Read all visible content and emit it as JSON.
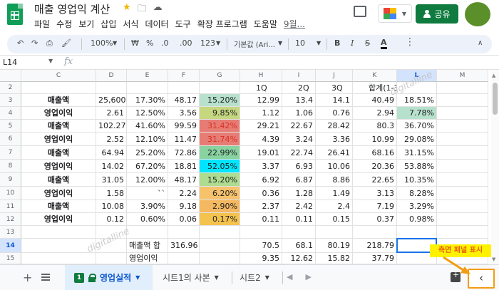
{
  "header": {
    "doc_title": "매출 영업익 계산",
    "menu": [
      "파일",
      "수정",
      "보기",
      "삽입",
      "서식",
      "데이터",
      "도구",
      "확장 프로그램",
      "도움말"
    ],
    "menu_last": "9월...",
    "share_label": "공유"
  },
  "toolbar": {
    "zoom": "100%",
    "currency": "₩",
    "percent": "%",
    "decimal_less": ".0",
    "decimal_more": ".00",
    "more_formats": "123",
    "font": "기본값 (Ari...",
    "font_size": "10",
    "bold": "B",
    "italic": "I",
    "strike": "S",
    "text_color": "A"
  },
  "formula_bar": {
    "name_box": "L14",
    "fx": "fx"
  },
  "columns": [
    "C",
    "D",
    "E",
    "F",
    "G",
    "H",
    "I",
    "J",
    "K",
    "L",
    "M"
  ],
  "selected_column": "L",
  "rows": [
    {
      "num": "2",
      "cells": [
        "",
        "",
        "",
        "",
        "",
        "1Q",
        "2Q",
        "3Q",
        "합계(1-3Q)",
        "",
        ""
      ]
    },
    {
      "num": "3",
      "cells": [
        "매출액",
        "25,600",
        "17.30%",
        "48.17",
        "15.20%",
        "12.99",
        "13.4",
        "14.1",
        "40.49",
        "18.51%",
        ""
      ]
    },
    {
      "num": "4",
      "cells": [
        "영업이익",
        "2.61",
        "12.50%",
        "3.56",
        "9.85%",
        "1.12",
        "1.06",
        "0.76",
        "2.94",
        "7.78%",
        ""
      ]
    },
    {
      "num": "5",
      "cells": [
        "매출액",
        "102.27",
        "41.60%",
        "99.59",
        "31.42%",
        "29.21",
        "22.67",
        "28.42",
        "80.3",
        "36.70%",
        ""
      ]
    },
    {
      "num": "6",
      "cells": [
        "영업이익",
        "2.52",
        "12.10%",
        "11.47",
        "31.74%",
        "4.39",
        "3.24",
        "3.36",
        "10.99",
        "29.08%",
        ""
      ]
    },
    {
      "num": "7",
      "cells": [
        "매출액",
        "64.94",
        "25.20%",
        "72.86",
        "22.99%",
        "19.01",
        "22.74",
        "26.41",
        "68.16",
        "31.15%",
        ""
      ]
    },
    {
      "num": "8",
      "cells": [
        "영업이익",
        "14.02",
        "67.20%",
        "18.81",
        "52.05%",
        "3.37",
        "6.93",
        "10.06",
        "20.36",
        "53.88%",
        ""
      ]
    },
    {
      "num": "9",
      "cells": [
        "매출액",
        "31.05",
        "12.00%",
        "48.17",
        "15.20%",
        "6.92",
        "6.87",
        "8.86",
        "22.65",
        "10.35%",
        ""
      ]
    },
    {
      "num": "10",
      "cells": [
        "영업이익",
        "1.58",
        "``",
        "2.24",
        "6.20%",
        "0.36",
        "1.28",
        "1.49",
        "3.13",
        "8.28%",
        ""
      ]
    },
    {
      "num": "11",
      "cells": [
        "매출액",
        "10.08",
        "3.90%",
        "9.18",
        "2.90%",
        "2.37",
        "2.42",
        "2.4",
        "7.19",
        "3.29%",
        ""
      ]
    },
    {
      "num": "12",
      "cells": [
        "영업이익",
        "0.12",
        "0.60%",
        "0.06",
        "0.17%",
        "0.11",
        "0.11",
        "0.15",
        "0.37",
        "0.98%",
        ""
      ]
    },
    {
      "num": "13",
      "cells": [
        "",
        "",
        "",
        "",
        "",
        "",
        "",
        "",
        "",
        "",
        ""
      ]
    },
    {
      "num": "14",
      "cells": [
        "",
        "",
        "매출액 합",
        "316.96",
        "",
        "70.5",
        "68.1",
        "80.19",
        "218.79",
        "",
        ""
      ]
    },
    {
      "num": "15",
      "cells": [
        "",
        "",
        "영업이익",
        "",
        "",
        "9.35",
        "12.62",
        "15.82",
        "37.79",
        "",
        ""
      ]
    }
  ],
  "g_colors": [
    "#b7e1cd",
    "#c5d77f",
    "#e67c73",
    "#e67c73",
    "#88d3a0",
    "#00e5ff",
    "#aedc90",
    "#f6c26b",
    "#f4b860",
    "#f4c24f"
  ],
  "l4_color": "#b7e1cd",
  "sheets": {
    "active_badge": "1",
    "active": "영업실적",
    "tab2": "시트1의 사본",
    "tab3": "시트2"
  },
  "annotation": {
    "callout": "측면 패널 표시"
  },
  "watermark": "digitalline"
}
